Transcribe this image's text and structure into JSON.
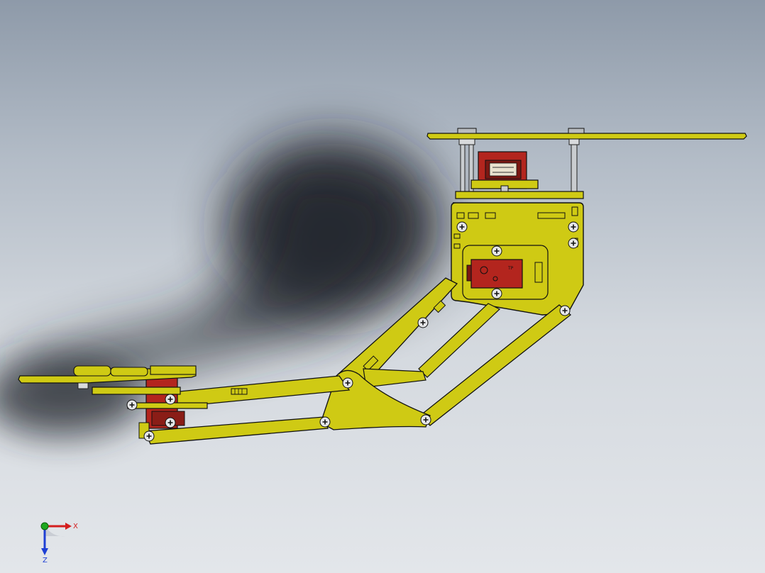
{
  "viewport": {
    "background_top": "#8e9aa9",
    "background_bottom": "#e3e6ea"
  },
  "model": {
    "part_color": "#cfca14",
    "part_edge": "#111111",
    "servo_color": "#b3251e",
    "standoff_color": "#c9cccf",
    "icon": "robot-arm-assembly-icon"
  },
  "triad": {
    "x_label": "X",
    "z_label": "Z",
    "x_color": "#d41e1e",
    "y_color": "#1ea81e",
    "z_color": "#1e3fd4"
  }
}
